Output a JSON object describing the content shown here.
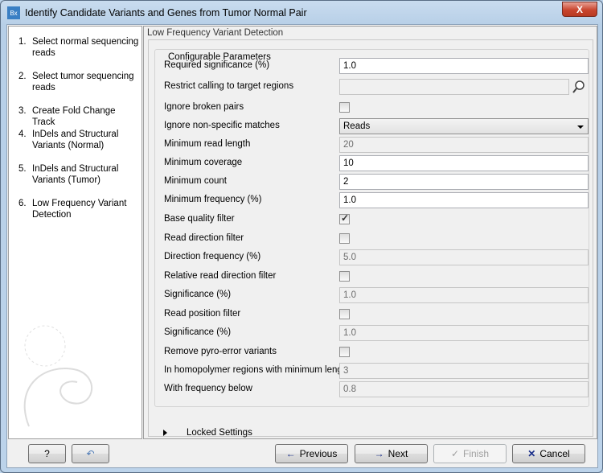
{
  "window": {
    "title": "Identify Candidate Variants and Genes from Tumor Normal Pair",
    "icon": "Bx",
    "close_label": "X"
  },
  "steps": [
    {
      "num": "1.",
      "label": "Select normal sequencing reads"
    },
    {
      "num": "2.",
      "label": "Select tumor sequencing reads"
    },
    {
      "num": "3.",
      "label": "Create Fold Change Track"
    },
    {
      "num": "4.",
      "label": "InDels and Structural Variants (Normal)"
    },
    {
      "num": "5.",
      "label": "InDels and Structural Variants (Tumor)"
    },
    {
      "num": "6.",
      "label": "Low Frequency Variant Detection"
    }
  ],
  "panel": {
    "title": "Low Frequency Variant Detection",
    "group_title": "Configurable Parameters",
    "locked_label": "Locked Settings"
  },
  "params": [
    {
      "label": "Required significance (%)",
      "type": "text",
      "value": "1.0"
    },
    {
      "label": "Restrict calling to target regions",
      "type": "browse",
      "value": ""
    },
    {
      "label": "Ignore broken pairs",
      "type": "checkbox",
      "checked": false
    },
    {
      "label": "Ignore non-specific matches",
      "type": "select",
      "value": "Reads"
    },
    {
      "label": "Minimum read length",
      "type": "disabled",
      "value": "20"
    },
    {
      "label": "Minimum coverage",
      "type": "text",
      "value": "10"
    },
    {
      "label": "Minimum count",
      "type": "text",
      "value": "2"
    },
    {
      "label": "Minimum frequency (%)",
      "type": "text",
      "value": "1.0"
    },
    {
      "label": "Base quality filter",
      "type": "checkbox",
      "checked": true
    },
    {
      "label": "Read direction filter",
      "type": "checkbox",
      "checked": false
    },
    {
      "label": "Direction frequency (%)",
      "type": "disabled",
      "value": "5.0"
    },
    {
      "label": "Relative read direction filter",
      "type": "checkbox",
      "checked": false
    },
    {
      "label": "Significance (%)",
      "type": "disabled",
      "value": "1.0"
    },
    {
      "label": "Read position filter",
      "type": "checkbox",
      "checked": false
    },
    {
      "label": "Significance (%)",
      "type": "disabled",
      "value": "1.0"
    },
    {
      "label": "Remove pyro-error variants",
      "type": "checkbox",
      "checked": false
    },
    {
      "label": "In homopolymer regions with minimum length",
      "type": "disabled",
      "value": "3"
    },
    {
      "label": "With frequency below",
      "type": "disabled",
      "value": "0.8"
    }
  ],
  "buttons": {
    "help": "?",
    "reset": "↶",
    "previous": "Previous",
    "next": "Next",
    "finish": "Finish",
    "cancel": "Cancel"
  }
}
